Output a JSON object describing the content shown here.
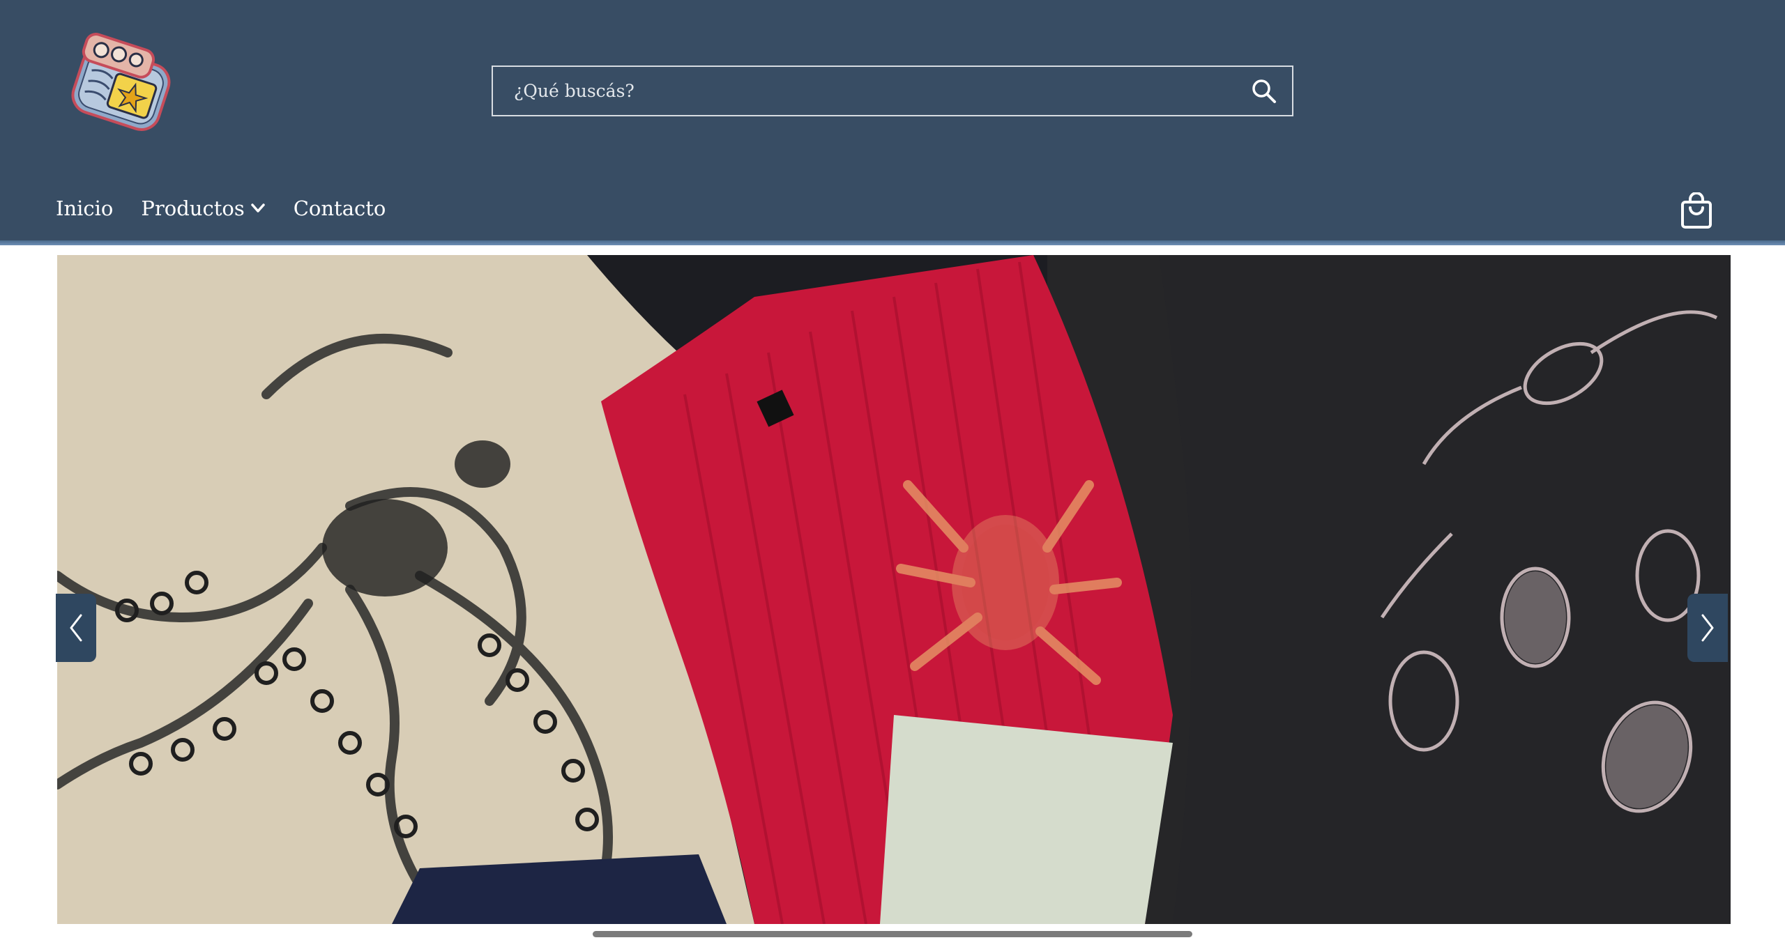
{
  "header": {
    "logo_icon": "sardine-tin-logo",
    "search": {
      "placeholder": "¿Qué buscás?",
      "value": "",
      "icon": "search-icon"
    },
    "nav": [
      {
        "label": "Inicio"
      },
      {
        "label": "Productos",
        "has_dropdown": true
      },
      {
        "label": "Contacto"
      }
    ],
    "cart_icon": "shopping-bag-icon"
  },
  "hero": {
    "image_description_icon": "clothing-photo",
    "prev_icon": "chevron-left-icon",
    "next_icon": "chevron-right-icon"
  },
  "colors": {
    "header_bg": "#384d64",
    "arrow_bg": "#2f4760",
    "accent": "#6d8fb5"
  }
}
